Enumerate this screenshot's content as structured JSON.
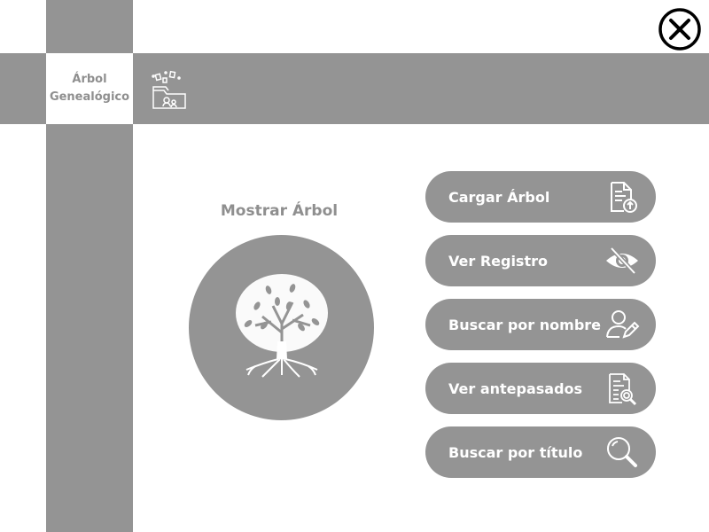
{
  "header": {
    "logo_line1": "Árbol",
    "logo_line2": "Genealógico"
  },
  "main": {
    "show_tree_label": "Mostrar Árbol"
  },
  "actions": [
    {
      "label": "Cargar Árbol",
      "icon": "upload-document-icon"
    },
    {
      "label": "Ver Registro",
      "icon": "eye-slash-icon"
    },
    {
      "label": "Buscar por nombre",
      "icon": "user-edit-icon"
    },
    {
      "label": "Ver antepasados",
      "icon": "document-search-icon"
    },
    {
      "label": "Buscar por título",
      "icon": "magnifier-icon"
    }
  ],
  "icons": {
    "close": "close-icon",
    "folder": "folder-icon",
    "tree": "tree-icon"
  },
  "colors": {
    "panel": "#949494",
    "text_muted": "#8f8f8f",
    "button_text": "#ffffff"
  }
}
